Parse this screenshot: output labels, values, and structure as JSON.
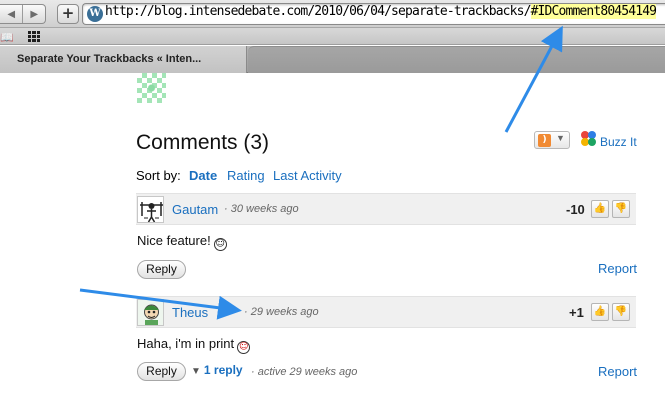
{
  "browser": {
    "back_icon": "back-arrow-icon",
    "forward_icon": "forward-arrow-icon",
    "add_bookmark_label": "+",
    "url_main": "http://blog.intensedebate.com/2010/06/04/separate-trackbacks/",
    "url_fragment": "#IDComment80454149",
    "tab_title": "Separate Your Trackbacks « Inten..."
  },
  "comments": {
    "title": "Comments (3)",
    "buzz_label": "Buzz It",
    "sort_label": "Sort by:",
    "sort_options": [
      "Date",
      "Rating",
      "Last Activity"
    ],
    "items": [
      {
        "author": "Gautam",
        "time": "· 30 weeks ago",
        "score": "-10",
        "text": "Nice feature!",
        "emoji": "☺",
        "reply_label": "Reply",
        "report_label": "Report"
      },
      {
        "author": "Theus",
        "time": "· 29 weeks ago",
        "score": "+1",
        "text": "Haha, i'm in print",
        "emoji": "☺",
        "reply_label": "Reply",
        "report_label": "Report",
        "replies_label": "1 reply",
        "active_time": "· active 29 weeks ago"
      }
    ]
  },
  "colors": {
    "link": "#1a6fbf",
    "url_highlight": "#ffff99",
    "annotation_arrow": "#2e8be8"
  }
}
